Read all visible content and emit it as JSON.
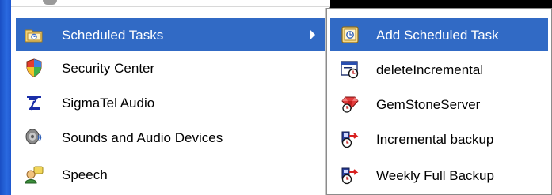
{
  "main_menu": {
    "items": [
      {
        "label": "Scheduled Tasks",
        "icon": "scheduled-tasks-folder-icon",
        "selected": true,
        "has_submenu": true
      },
      {
        "label": "Security Center",
        "icon": "security-shield-icon",
        "selected": false
      },
      {
        "label": "SigmaTel Audio",
        "icon": "sigmatel-audio-icon",
        "selected": false
      },
      {
        "label": "Sounds and Audio Devices",
        "icon": "speaker-icon",
        "selected": false
      },
      {
        "label": "Speech",
        "icon": "speech-icon",
        "selected": false
      }
    ]
  },
  "submenu": {
    "items": [
      {
        "label": "Add Scheduled Task",
        "icon": "add-task-icon",
        "selected": true
      },
      {
        "label": "deleteIncremental",
        "icon": "task-window-clock-icon",
        "selected": false
      },
      {
        "label": "GemStoneServer",
        "icon": "gem-task-icon",
        "selected": false
      },
      {
        "label": "Incremental backup",
        "icon": "backup-task-icon",
        "selected": false
      },
      {
        "label": "Weekly Full Backup",
        "icon": "backup-task-icon",
        "selected": false
      }
    ]
  },
  "colors": {
    "highlight": "#316ac5",
    "menu_bg": "#ffffff",
    "start_strip": "#1a4fc4"
  }
}
